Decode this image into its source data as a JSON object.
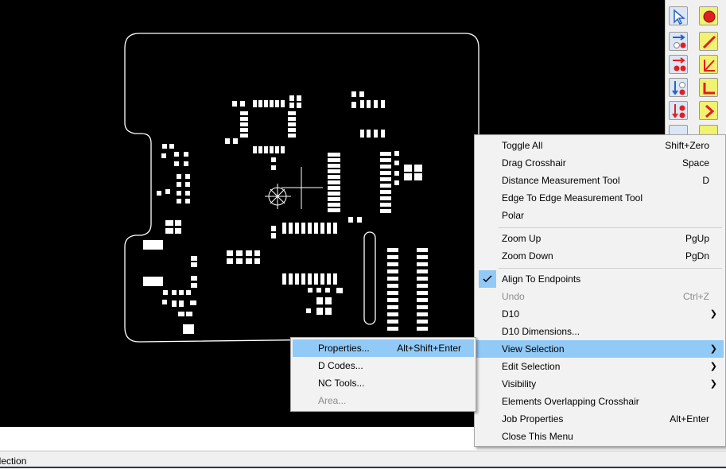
{
  "status_bar": {
    "text": "election"
  },
  "toolbar": {
    "icons": [
      "select-arrow-icon",
      "circle-icon",
      "move-icon",
      "line-icon",
      "move-red-icon",
      "angle-icon",
      "move-down-icon",
      "corner-icon",
      "move-down-red-icon",
      "chevron-right-icon"
    ]
  },
  "context_menu": {
    "items": [
      {
        "label": "Toggle All",
        "shortcut": "Shift+Zero"
      },
      {
        "label": "Drag Crosshair",
        "shortcut": "Space"
      },
      {
        "label": "Distance Measurement Tool",
        "shortcut": "D"
      },
      {
        "label": "Edge To Edge Measurement Tool",
        "shortcut": ""
      },
      {
        "label": "Polar",
        "shortcut": ""
      },
      {
        "label": "Zoom Up",
        "shortcut": "PgUp"
      },
      {
        "label": "Zoom Down",
        "shortcut": "PgDn"
      },
      {
        "label": "Align To Endpoints",
        "shortcut": "",
        "checked": true
      },
      {
        "label": "Undo",
        "shortcut": "Ctrl+Z",
        "disabled": true
      },
      {
        "label": "D10",
        "shortcut": "",
        "submenu": true
      },
      {
        "label": "D10 Dimensions...",
        "shortcut": ""
      },
      {
        "label": "View Selection",
        "shortcut": "",
        "submenu": true,
        "highlighted": true
      },
      {
        "label": "Edit Selection",
        "shortcut": "",
        "submenu": true
      },
      {
        "label": "Visibility",
        "shortcut": "",
        "submenu": true
      },
      {
        "label": "Elements Overlapping Crosshair",
        "shortcut": ""
      },
      {
        "label": "Job Properties",
        "shortcut": "Alt+Enter"
      },
      {
        "label": "Close This Menu",
        "shortcut": ""
      }
    ]
  },
  "submenu": {
    "items": [
      {
        "label": "Properties...",
        "shortcut": "Alt+Shift+Enter",
        "highlighted": true
      },
      {
        "label": "D Codes...",
        "shortcut": ""
      },
      {
        "label": "NC Tools...",
        "shortcut": ""
      },
      {
        "label": "Area...",
        "shortcut": "",
        "disabled": true
      }
    ]
  },
  "colors": {
    "canvas": "#000000",
    "pad": "#ffffff",
    "highlight": "#91c9f7",
    "menu_bg": "#f2f2f2"
  }
}
